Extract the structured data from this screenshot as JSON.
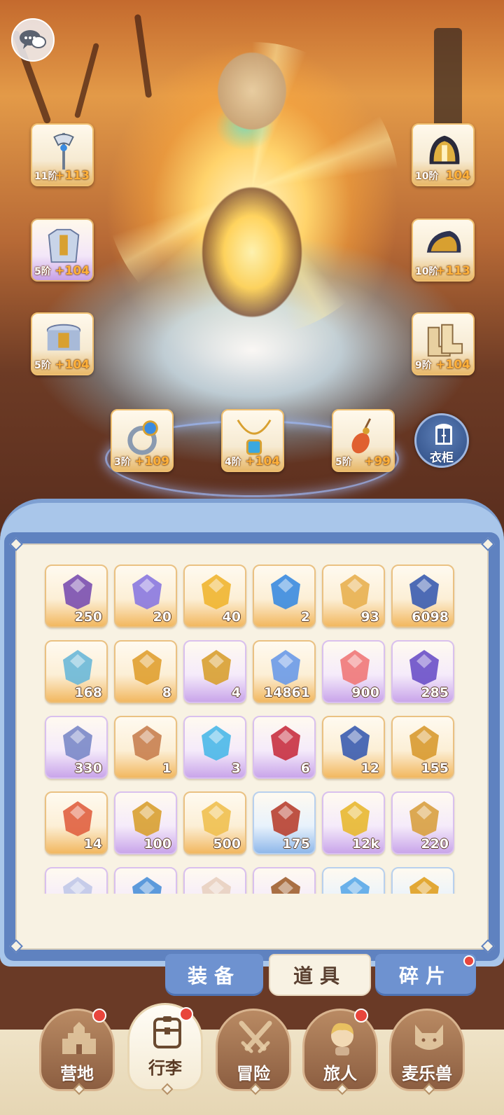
{
  "chat_icon": "chat-bubbles-icon",
  "equipment_slots": [
    {
      "name": "weapon-slot",
      "icon": "halberd-icon",
      "level": "11阶",
      "bonus": "+113",
      "tier": "orange"
    },
    {
      "name": "helmet-slot",
      "icon": "helmet-icon",
      "level": "10阶",
      "bonus": "104",
      "tier": "orange"
    },
    {
      "name": "armor-slot",
      "icon": "chest-armor-icon",
      "level": "5阶",
      "bonus": "+104",
      "tier": "purple"
    },
    {
      "name": "shoulder-slot",
      "icon": "pauldron-icon",
      "level": "10阶",
      "bonus": "+113",
      "tier": "orange"
    },
    {
      "name": "belt-slot",
      "icon": "armor-belt-icon",
      "level": "5阶",
      "bonus": "+104",
      "tier": "orange"
    },
    {
      "name": "boots-slot",
      "icon": "boots-icon",
      "level": "9阶",
      "bonus": "+104",
      "tier": "orange"
    },
    {
      "name": "ring-slot",
      "icon": "ring-icon",
      "level": "3阶",
      "bonus": "+109",
      "tier": "orange"
    },
    {
      "name": "necklace-slot",
      "icon": "necklace-icon",
      "level": "4阶",
      "bonus": "+104",
      "tier": "orange"
    },
    {
      "name": "amulet-slot",
      "icon": "amulet-icon",
      "level": "5阶",
      "bonus": "+99",
      "tier": "orange"
    }
  ],
  "wardrobe": {
    "label": "衣柜",
    "icon": "wardrobe-icon"
  },
  "inventory": {
    "items": [
      {
        "icon": "ticket-icon",
        "count": "250",
        "tier": "orange",
        "color": "#7a4fb0"
      },
      {
        "icon": "paper-plane-icon",
        "count": "20",
        "tier": "orange",
        "color": "#8a78e0"
      },
      {
        "icon": "gold-gem-icon",
        "count": "40",
        "tier": "orange",
        "color": "#f0b530"
      },
      {
        "icon": "blue-potion-icon",
        "count": "2",
        "tier": "orange",
        "color": "#3a8be0"
      },
      {
        "icon": "lyre-icon",
        "count": "93",
        "tier": "orange",
        "color": "#e8b050"
      },
      {
        "icon": "portal-orb-icon",
        "count": "6098",
        "tier": "orange",
        "color": "#3a5cb0"
      },
      {
        "icon": "ice-crystal-icon",
        "count": "168",
        "tier": "orange",
        "color": "#6ab8d8"
      },
      {
        "icon": "bell-icon",
        "count": "8",
        "tier": "orange",
        "color": "#e0a030"
      },
      {
        "icon": "horseshoe-icon",
        "count": "4",
        "tier": "purple",
        "color": "#d8a030"
      },
      {
        "icon": "star-crystal-icon",
        "count": "14861",
        "tier": "orange",
        "color": "#6a9ae8"
      },
      {
        "icon": "heart-icon",
        "count": "900",
        "tier": "purple",
        "color": "#f07878"
      },
      {
        "icon": "purple-gem-icon",
        "count": "285",
        "tier": "purple",
        "color": "#6a50c8"
      },
      {
        "icon": "heart-coin-icon",
        "count": "330",
        "tier": "purple",
        "color": "#7a88c8"
      },
      {
        "icon": "ore-icon",
        "count": "1",
        "tier": "orange",
        "color": "#c88050"
      },
      {
        "icon": "cyan-potion-icon",
        "count": "3",
        "tier": "purple",
        "color": "#4ab8e8"
      },
      {
        "icon": "red-potion-icon",
        "count": "6",
        "tier": "purple",
        "color": "#c83040"
      },
      {
        "icon": "blue-card-icon",
        "count": "12",
        "tier": "orange",
        "color": "#3a5cb0"
      },
      {
        "icon": "gold-card-icon",
        "count": "155",
        "tier": "orange",
        "color": "#d89a30"
      },
      {
        "icon": "red-card-icon",
        "count": "14",
        "tier": "orange",
        "color": "#e06040"
      },
      {
        "icon": "cat-mirror-icon",
        "count": "100",
        "tier": "purple",
        "color": "#d8a030"
      },
      {
        "icon": "cheese-icon",
        "count": "500",
        "tier": "orange",
        "color": "#f0c050"
      },
      {
        "icon": "meat-icon",
        "count": "175",
        "tier": "blue",
        "color": "#b84030"
      },
      {
        "icon": "gold-leaf-icon",
        "count": "12k",
        "tier": "purple",
        "color": "#e8b830"
      },
      {
        "icon": "star-cookie-icon",
        "count": "220",
        "tier": "purple",
        "color": "#d8a040"
      },
      {
        "icon": "bottle-icon",
        "count": "",
        "tier": "purple",
        "color": "#c0c8e8"
      },
      {
        "icon": "blue-item-icon",
        "count": "",
        "tier": "purple",
        "color": "#4a90d8"
      },
      {
        "icon": "box-icon",
        "count": "",
        "tier": "purple",
        "color": "#e8d0c0"
      },
      {
        "icon": "book-icon",
        "count": "",
        "tier": "purple",
        "color": "#a06030"
      },
      {
        "icon": "shard-icon",
        "count": "",
        "tier": "blue",
        "color": "#5aa8e8"
      },
      {
        "icon": "gold-item-icon",
        "count": "",
        "tier": "blue",
        "color": "#e0a020"
      }
    ]
  },
  "tabs": [
    {
      "label": "装备",
      "active": false
    },
    {
      "label": "道具",
      "active": true
    },
    {
      "label": "碎片",
      "active": false,
      "badge": true
    }
  ],
  "bottom_nav": [
    {
      "label": "营地",
      "icon": "castle-icon",
      "active": false,
      "badge": true
    },
    {
      "label": "行李",
      "icon": "backpack-icon",
      "active": true,
      "badge": true
    },
    {
      "label": "冒险",
      "icon": "crossed-swords-icon",
      "active": false,
      "badge": false
    },
    {
      "label": "旅人",
      "icon": "traveler-icon",
      "active": false,
      "badge": true
    },
    {
      "label": "麦乐兽",
      "icon": "cat-pet-icon",
      "active": false,
      "badge": false
    }
  ]
}
